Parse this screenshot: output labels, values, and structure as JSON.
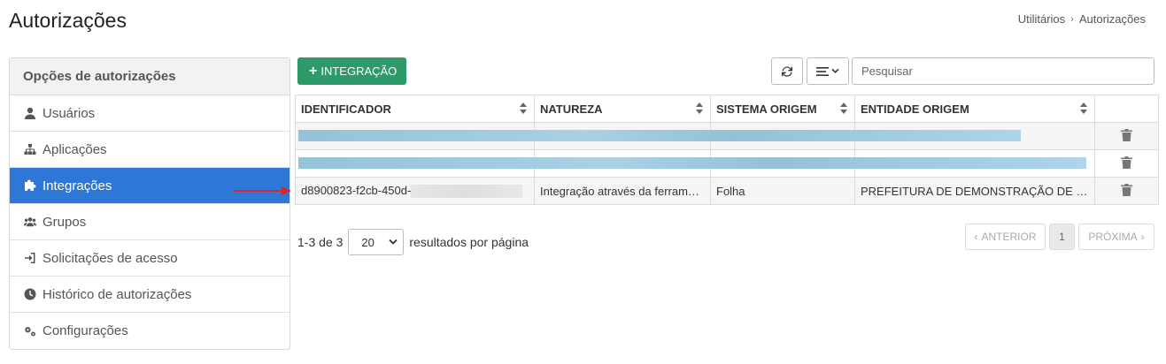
{
  "page": {
    "title": "Autorizações"
  },
  "breadcrumb": {
    "items": [
      "Utilitários",
      "Autorizações"
    ],
    "separator": "›"
  },
  "sidebar": {
    "header": "Opções de autorizações",
    "items": [
      {
        "label": "Usuários",
        "icon": "user-icon"
      },
      {
        "label": "Aplicações",
        "icon": "sitemap-icon"
      },
      {
        "label": "Integrações",
        "icon": "puzzle-icon",
        "active": true
      },
      {
        "label": "Grupos",
        "icon": "users-icon"
      },
      {
        "label": "Solicitações de acesso",
        "icon": "sign-in-icon"
      },
      {
        "label": "Histórico de autorizações",
        "icon": "clock-icon"
      },
      {
        "label": "Configurações",
        "icon": "gears-icon"
      }
    ]
  },
  "toolbar": {
    "add_label": "INTEGRAÇÃO",
    "search_placeholder": "Pesquisar"
  },
  "table": {
    "columns": [
      "IDENTIFICADOR",
      "NATUREZA",
      "SISTEMA ORIGEM",
      "ENTIDADE ORIGEM"
    ],
    "rows": [
      {
        "identificador": "",
        "natureza": "",
        "sistema": "",
        "entidade": "",
        "redacted": true
      },
      {
        "identificador": "",
        "natureza": "",
        "sistema": "",
        "entidade": "",
        "redacted": true
      },
      {
        "identificador": "d8900823-f2cb-450d-",
        "natureza": "Integração através da ferramenta",
        "sistema": "Folha",
        "entidade": "PREFEITURA DE DEMONSTRAÇÃO DE EDIFICAÇÕES"
      }
    ]
  },
  "footer": {
    "count": "1-3 de 3",
    "page_size": "20",
    "per_page_label": "resultados por página"
  },
  "pagination": {
    "prev": "ANTERIOR",
    "current": "1",
    "next": "PRÓXIMA"
  },
  "colors": {
    "active": "#2f77d6",
    "add_button": "#2e9a6a",
    "arrow": "#d9232d"
  }
}
